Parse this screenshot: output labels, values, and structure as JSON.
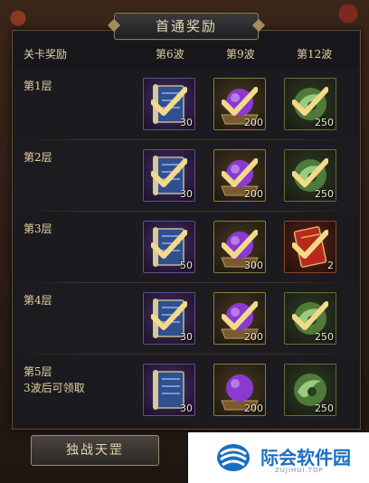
{
  "title": "首通奖励",
  "header": {
    "col0": "关卡奖励",
    "col1": "第6波",
    "col2": "第9波",
    "col3": "第12波"
  },
  "rows": [
    {
      "label": "第1层",
      "sub": "",
      "rewards": [
        {
          "icon": "blue-scroll-icon",
          "qty": "30",
          "claimed": true
        },
        {
          "icon": "purple-orb-icon",
          "qty": "200",
          "claimed": true
        },
        {
          "icon": "green-jade-icon",
          "qty": "250",
          "claimed": true
        }
      ]
    },
    {
      "label": "第2层",
      "sub": "",
      "rewards": [
        {
          "icon": "blue-scroll-icon",
          "qty": "30",
          "claimed": true
        },
        {
          "icon": "purple-orb-icon",
          "qty": "200",
          "claimed": true
        },
        {
          "icon": "green-jade-icon",
          "qty": "250",
          "claimed": true
        }
      ]
    },
    {
      "label": "第3层",
      "sub": "",
      "rewards": [
        {
          "icon": "blue-scroll-icon",
          "qty": "50",
          "claimed": true
        },
        {
          "icon": "purple-orb-icon",
          "qty": "300",
          "claimed": true
        },
        {
          "icon": "red-envelope-icon",
          "qty": "2",
          "claimed": true
        }
      ]
    },
    {
      "label": "第4层",
      "sub": "",
      "rewards": [
        {
          "icon": "blue-scroll-icon",
          "qty": "30",
          "claimed": true
        },
        {
          "icon": "purple-orb-icon",
          "qty": "200",
          "claimed": true
        },
        {
          "icon": "green-jade-icon",
          "qty": "250",
          "claimed": true
        }
      ]
    },
    {
      "label": "第5层",
      "sub": "3波后可领取",
      "rewards": [
        {
          "icon": "blue-scroll-icon",
          "qty": "30",
          "claimed": false
        },
        {
          "icon": "purple-orb-icon",
          "qty": "200",
          "claimed": false
        },
        {
          "icon": "green-jade-icon",
          "qty": "250",
          "claimed": false
        }
      ]
    }
  ],
  "bottom": {
    "button_label": "独战天罡"
  },
  "watermark": {
    "name": "际会软件园",
    "domain": "ZUJIHUI.TOP"
  },
  "colors": {
    "accent_gold": "#e6d3a2",
    "panel_bg": "#17161a",
    "check_gold": "#f3d98a"
  }
}
